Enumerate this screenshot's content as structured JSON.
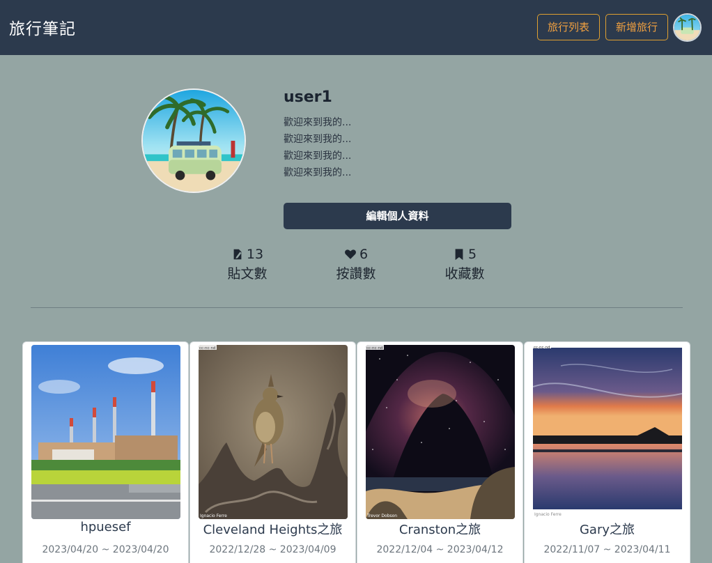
{
  "header": {
    "brand": "旅行筆記",
    "trip_list_label": "旅行列表",
    "add_trip_label": "新增旅行"
  },
  "profile": {
    "username": "user1",
    "bio_lines": [
      "歡迎來到我的...",
      "歡迎來到我的...",
      "歡迎來到我的...",
      "歡迎來到我的..."
    ],
    "edit_label": "編輯個人資料"
  },
  "stats": [
    {
      "icon": "post-icon",
      "count": "13",
      "label": "貼文數"
    },
    {
      "icon": "heart-icon",
      "count": "6",
      "label": "按讚數"
    },
    {
      "icon": "bookmark-icon",
      "count": "5",
      "label": "收藏數"
    }
  ],
  "cards": [
    {
      "title": "hpuesef",
      "dates": "2023/04/20 ~ 2023/04/20"
    },
    {
      "title": "Cleveland Heights之旅",
      "dates": "2022/12/28 ~ 2023/04/09",
      "photo_credit": "Ignacio Ferre",
      "photo_license": "cc-nc-nd"
    },
    {
      "title": "Cranston之旅",
      "dates": "2022/12/04 ~ 2023/04/12",
      "photo_credit": "Trevor Dobson",
      "photo_license": "cc-nc-nd"
    },
    {
      "title": "Gary之旅",
      "dates": "2022/11/07 ~ 2023/04/11",
      "photo_credit": "Ignacio Ferre",
      "photo_license": "cc-nc-nd"
    }
  ],
  "colors": {
    "page_bg": "#94a5a3",
    "navbar_bg": "#2c3a4d",
    "accent_orange": "#f0a040"
  }
}
